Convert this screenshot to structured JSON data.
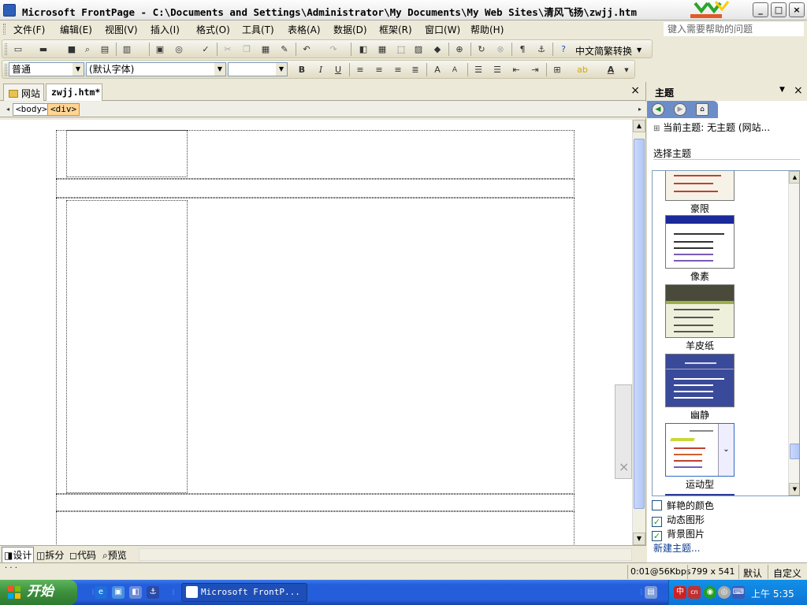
{
  "window": {
    "title": "Microsoft FrontPage - C:\\Documents and Settings\\Administrator\\My Documents\\My Web Sites\\清风飞扬\\zwjj.htm",
    "controls": {
      "minimize": "_",
      "maximize": "□",
      "close": "×"
    }
  },
  "menubar": {
    "items": [
      "文件(F)",
      "编辑(E)",
      "视图(V)",
      "插入(I)",
      "格式(O)",
      "工具(T)",
      "表格(A)",
      "数据(D)",
      "框架(R)",
      "窗口(W)",
      "帮助(H)"
    ],
    "help_placeholder": "键入需要帮助的问题"
  },
  "toolbar_standard": {
    "convert_label": "中文简繁转换"
  },
  "toolbar_format": {
    "style_value": "普通",
    "font_value": "(默认字体)",
    "size_value": ""
  },
  "doc_tabs": {
    "site": "网站",
    "page": "zwjj.htm*",
    "close": "×"
  },
  "quick_tags": [
    "<body>",
    "<div>"
  ],
  "view_tabs": [
    "设计",
    "拆分",
    "代码",
    "预览"
  ],
  "task_pane": {
    "title": "主题",
    "current_theme": "当前主题:  无主题  (网站...",
    "choose_label": "选择主题",
    "themes": [
      {
        "label": "豪限",
        "style": "text"
      },
      {
        "label": "像素",
        "style": "pixel"
      },
      {
        "label": "羊皮纸",
        "style": "parchment"
      },
      {
        "label": "幽静",
        "style": "calm"
      },
      {
        "label": "运动型",
        "style": "sport"
      }
    ],
    "options": [
      {
        "label": "鲜艳的颜色",
        "checked": false
      },
      {
        "label": "动态图形",
        "checked": true
      },
      {
        "label": "背景图片",
        "checked": true
      }
    ],
    "new_theme": "新建主题..."
  },
  "statusbar": {
    "download": "0:01@56Kbps",
    "dimensions": "799 x 541",
    "default": "默认",
    "custom": "自定义"
  },
  "taskbar": {
    "start": "开始",
    "task_item": "Microsoft FrontP...",
    "clock": "上午 5:35"
  }
}
